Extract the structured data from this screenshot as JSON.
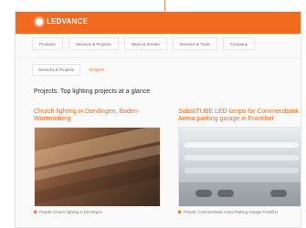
{
  "brand": {
    "name": "LEDVANCE",
    "bar_color": "#f26a1f",
    "accent": "#ff6a1a"
  },
  "nav": {
    "items": [
      "Products",
      "Services & Projects",
      "News & Stories",
      "Services & Tools",
      "Company"
    ]
  },
  "subnav": {
    "items": [
      "Services & Projects",
      "Projects"
    ],
    "active_index": 1
  },
  "page": {
    "title": "Projects: Top lighting projects at a glance"
  },
  "cards": [
    {
      "title_lines": [
        "Church lighting in Dervlingen, Baden-",
        "Württemberg"
      ],
      "image_icon": "church-interior-image",
      "caption": "Projekt: Church lighting in Dervlingen"
    },
    {
      "title_lines": [
        "SubstiTUBE LED lamps for Commerzbank",
        "Arena parking garage in Frankfurt"
      ],
      "image_icon": "parking-garage-image",
      "caption": "Projekt: Commerzbank Arena Parking Garage Frankfurt"
    }
  ]
}
